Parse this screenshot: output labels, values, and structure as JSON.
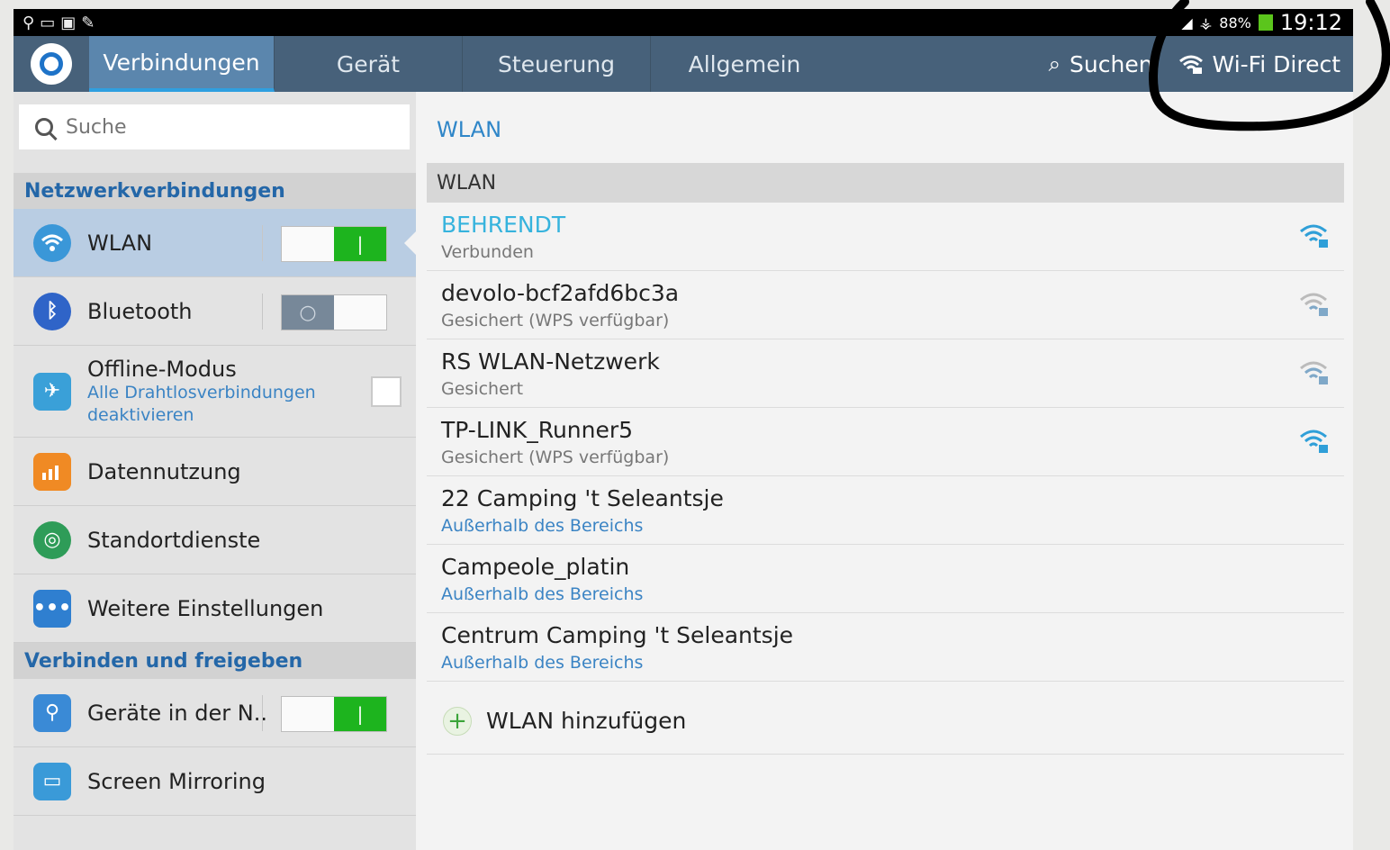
{
  "statusbar": {
    "battery": "88%",
    "time": "19:12"
  },
  "actionbar": {
    "tabs": [
      "Verbindungen",
      "Gerät",
      "Steuerung",
      "Allgemein"
    ],
    "search_label": "Suchen",
    "wifi_direct_label": "Wi-Fi Direct"
  },
  "sidebar": {
    "search_placeholder": "Suche",
    "section1": "Netzwerkverbindungen",
    "section2": "Verbinden und freigeben",
    "items": [
      {
        "label": "WLAN",
        "toggle": "on"
      },
      {
        "label": "Bluetooth",
        "toggle": "off"
      },
      {
        "label": "Offline-Modus",
        "sub": "Alle Drahtlosverbindungen deaktivieren",
        "checked": false
      },
      {
        "label": "Datennutzung"
      },
      {
        "label": "Standortdienste"
      },
      {
        "label": "Weitere Einstellungen"
      },
      {
        "label": "Geräte in der N..",
        "toggle": "on"
      },
      {
        "label": "Screen Mirroring"
      }
    ]
  },
  "main": {
    "title": "WLAN",
    "header": "WLAN",
    "networks": [
      {
        "name": "BEHRENDT",
        "status": "Verbunden"
      },
      {
        "name": "devolo-bcf2afd6bc3a",
        "status": "Gesichert (WPS verfügbar)"
      },
      {
        "name": "RS WLAN-Netzwerk",
        "status": "Gesichert"
      },
      {
        "name": "TP-LINK_Runner5",
        "status": "Gesichert (WPS verfügbar)"
      },
      {
        "name": "22 Camping 't Seleantsje",
        "status": "Außerhalb des Bereichs"
      },
      {
        "name": "Campeole_platin",
        "status": "Außerhalb des Bereichs"
      },
      {
        "name": "Centrum Camping 't Seleantsje",
        "status": "Außerhalb des Bereichs"
      }
    ],
    "add_network": "WLAN hinzufügen"
  },
  "colors": {
    "actionbar": "#47617a",
    "accent": "#2f86c8",
    "toggle_on": "#1db41e"
  }
}
